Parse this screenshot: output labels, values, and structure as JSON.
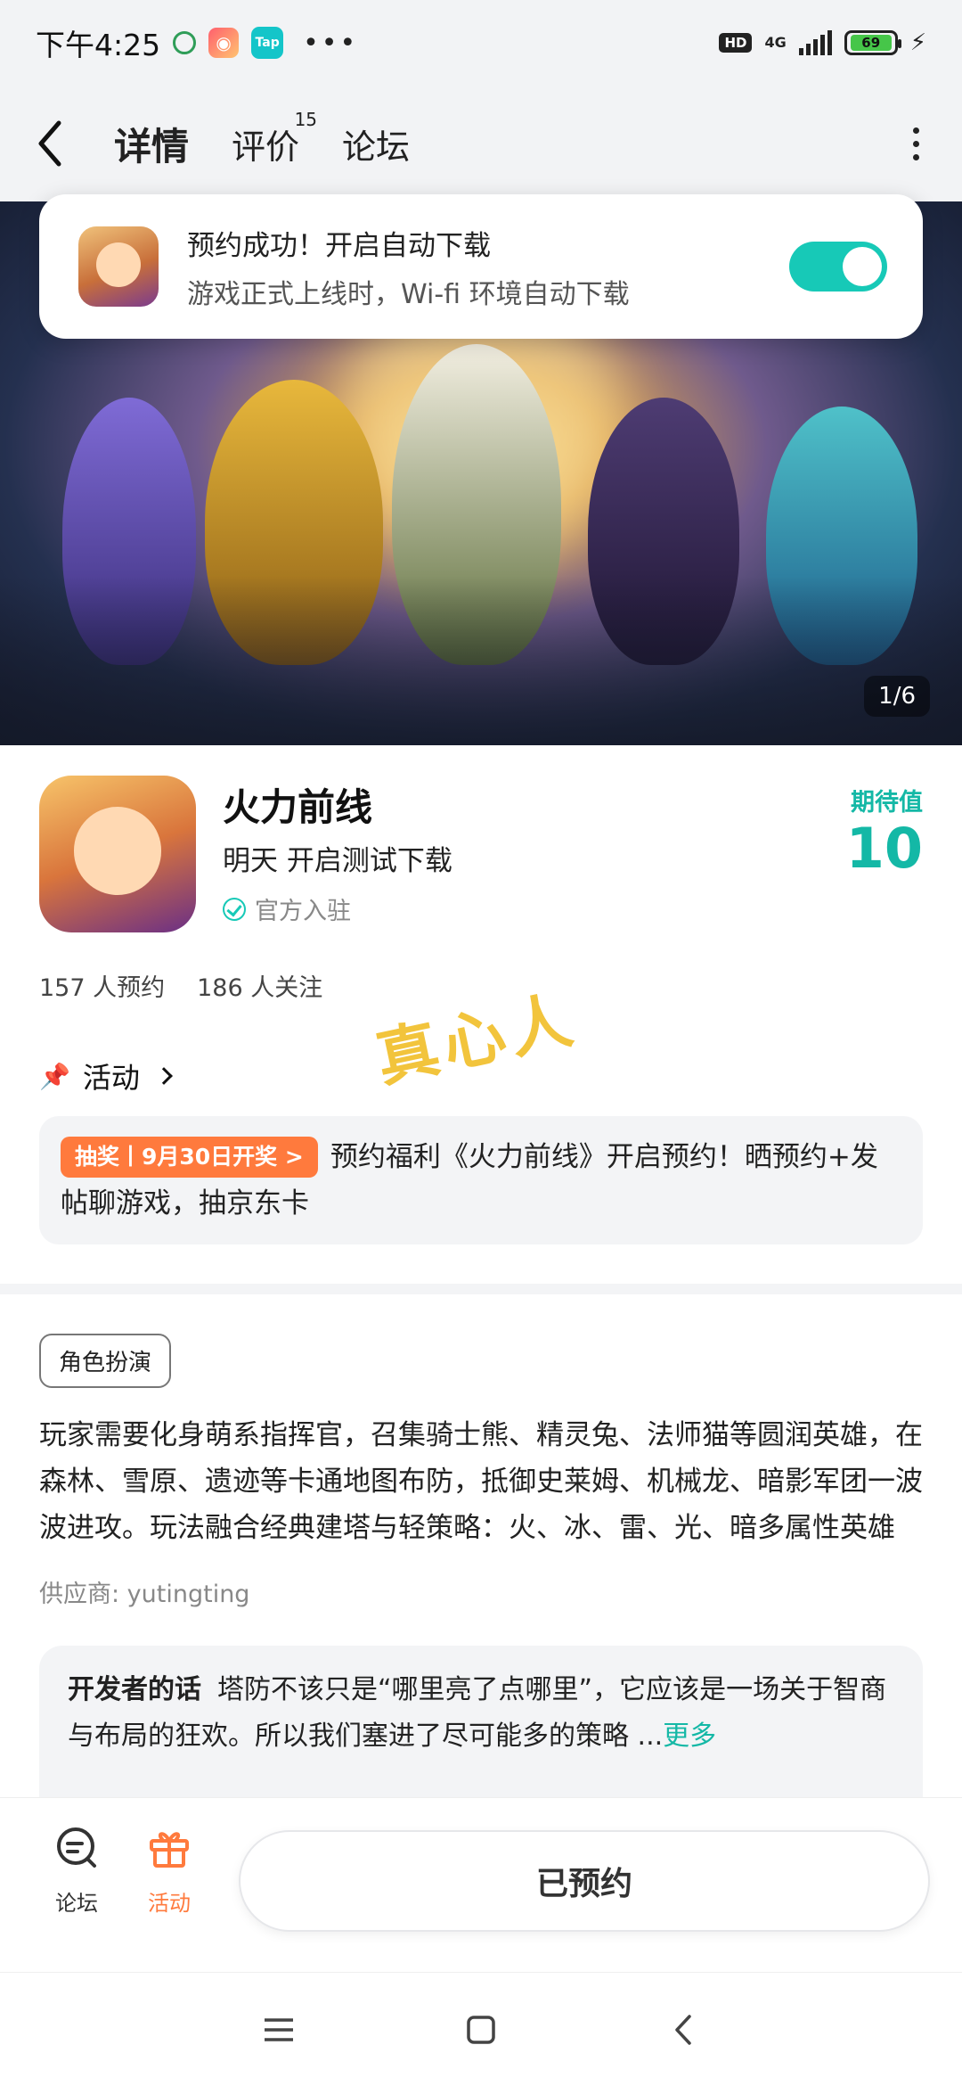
{
  "status_bar": {
    "time": "下午4:25",
    "hd": "HD",
    "network": "4G",
    "battery": "69",
    "game_icon": "gamepad-icon",
    "tap_label": "Tap"
  },
  "nav": {
    "tabs": [
      {
        "label": "详情",
        "active": true
      },
      {
        "label": "评价",
        "badge": "15"
      },
      {
        "label": "论坛"
      }
    ]
  },
  "toast": {
    "title": "预约成功！开启自动下载",
    "subtitle": "游戏正式上线时，Wi-fi 环境自动下载",
    "toggle_on": true
  },
  "banner": {
    "page_indicator": "1/6"
  },
  "app": {
    "name": "火力前线",
    "subtitle": "明天 开启测试下载",
    "official": "官方入驻",
    "expect_label": "期待值",
    "expect_value": "10",
    "reservations": "157 人预约",
    "followers": "186 人关注"
  },
  "watermark": "真心人",
  "activity": {
    "heading": "活动",
    "tag": "抽奖丨9月30日开奖 >",
    "text": "预约福利《火力前线》开启预约！晒预约+发帖聊游戏，抽京东卡"
  },
  "details": {
    "genre": "角色扮演",
    "description": "玩家需要化身萌系指挥官，召集骑士熊、精灵兔、法师猫等圆润英雄，在森林、雪原、遗迹等卡通地图布防，抵御史莱姆、机械龙、暗影军团一波波进攻。玩法融合经典建塔与轻策略：火、冰、雷、光、暗多属性英雄",
    "supplier": "供应商: yutingting"
  },
  "developer": {
    "label": "开发者的话",
    "text": "塔防不该只是“哪里亮了点哪里”，它应该是一场关于智商与布局的狂欢。所以我们塞进了尽可能多的策略 ...",
    "more": "更多"
  },
  "bottom_bar": {
    "forum_label": "论坛",
    "activity_label": "活动",
    "reserved_label": "已预约"
  },
  "colors": {
    "accent": "#14b8a6",
    "toggle": "#17c9b7",
    "activity_tag": "#ff7a3d"
  }
}
